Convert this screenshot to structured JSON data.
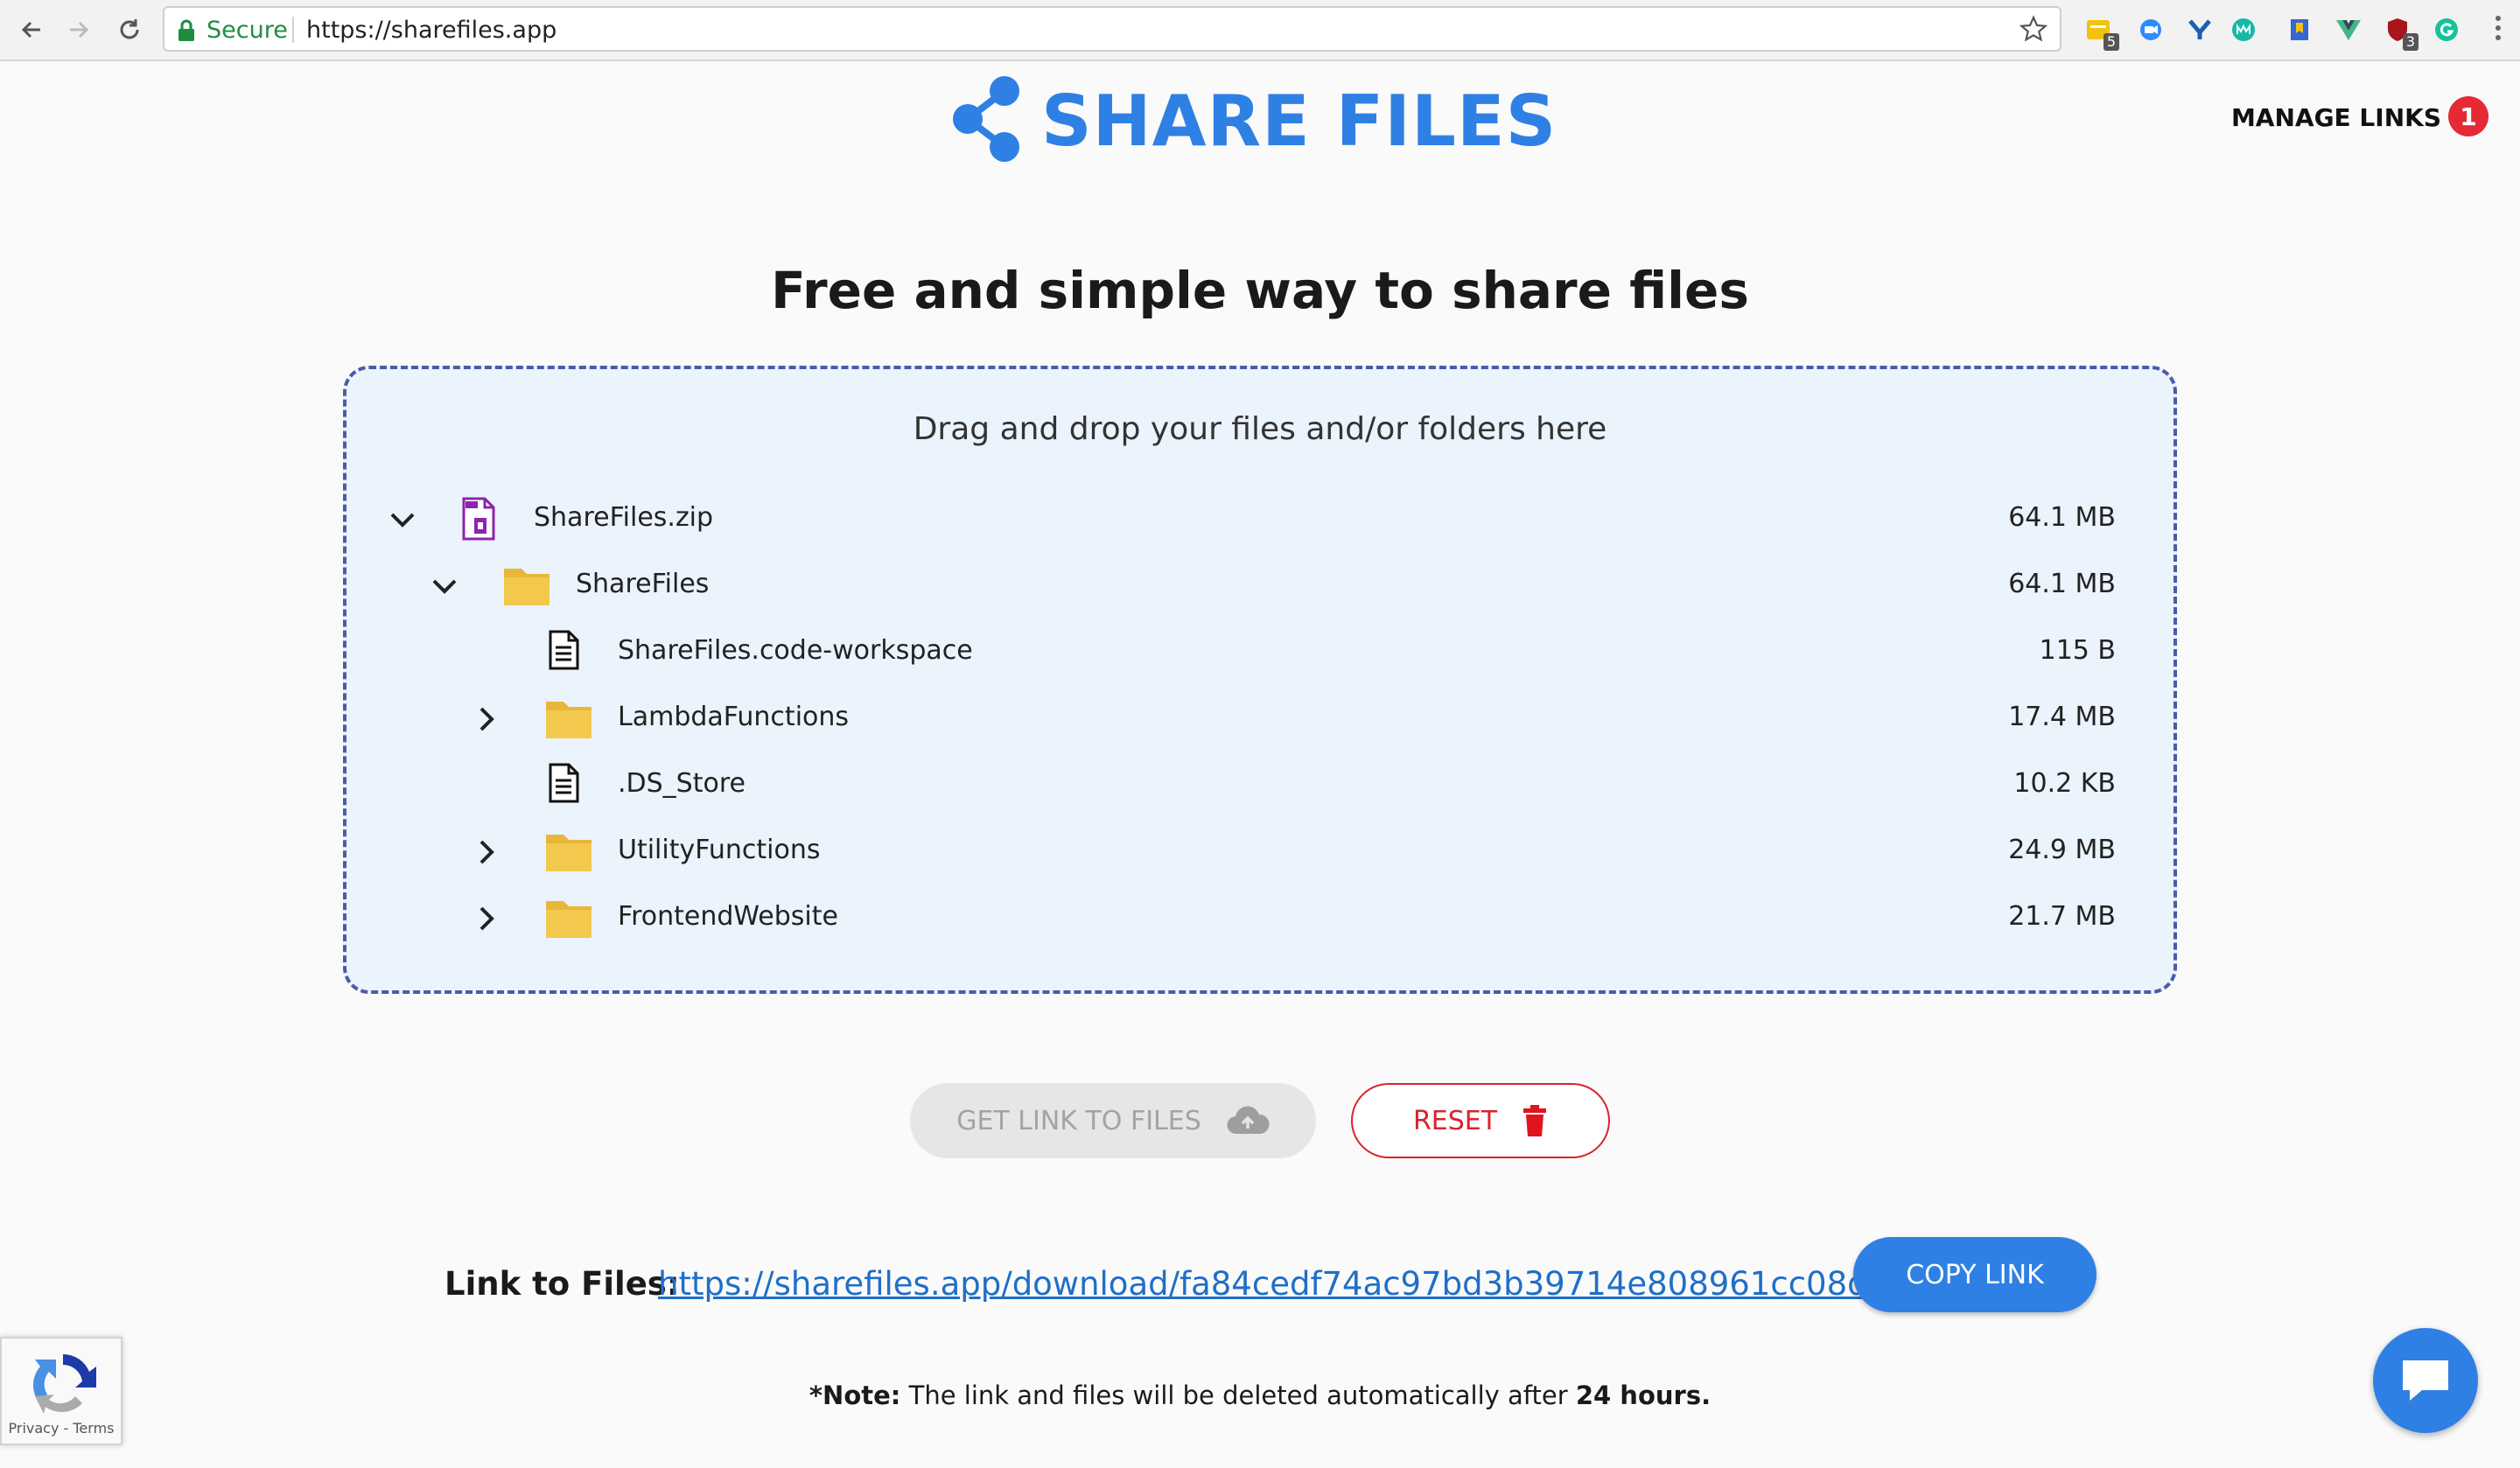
{
  "browser": {
    "secure_label": "Secure",
    "url": "https://sharefiles.app",
    "extensions": [
      {
        "icon": "notes-extension-icon",
        "badge": "5"
      },
      {
        "icon": "video-extension-icon",
        "badge": ""
      },
      {
        "icon": "y-extension-icon",
        "badge": ""
      },
      {
        "icon": "m-extension-icon",
        "badge": ""
      },
      {
        "icon": "bookmark-extension-icon",
        "badge": ""
      },
      {
        "icon": "vue-devtools-icon",
        "badge": ""
      },
      {
        "icon": "shield-extension-icon",
        "badge": "3"
      },
      {
        "icon": "grammarly-icon",
        "badge": ""
      }
    ]
  },
  "header": {
    "logo_text": "SHARE FILES",
    "manage_links_label": "MANAGE LINKS",
    "manage_links_count": "1"
  },
  "main": {
    "headline": "Free and simple way to share files",
    "drop_hint": "Drag and drop your files and/or folders here",
    "files": [
      {
        "name": "ShareFiles.zip",
        "size": "64.1 MB",
        "type": "zip",
        "depth": 0,
        "toggle": "expanded"
      },
      {
        "name": "ShareFiles",
        "size": "64.1 MB",
        "type": "folder",
        "depth": 1,
        "toggle": "expanded"
      },
      {
        "name": "ShareFiles.code-workspace",
        "size": "115 B",
        "type": "file",
        "depth": 2,
        "toggle": "none"
      },
      {
        "name": "LambdaFunctions",
        "size": "17.4 MB",
        "type": "folder",
        "depth": 2,
        "toggle": "collapsed"
      },
      {
        "name": ".DS_Store",
        "size": "10.2 KB",
        "type": "file",
        "depth": 2,
        "toggle": "none"
      },
      {
        "name": "UtilityFunctions",
        "size": "24.9 MB",
        "type": "folder",
        "depth": 2,
        "toggle": "collapsed"
      },
      {
        "name": "FrontendWebsite",
        "size": "21.7 MB",
        "type": "folder",
        "depth": 2,
        "toggle": "collapsed"
      }
    ],
    "get_link_label": "GET LINK TO FILES",
    "reset_label": "RESET",
    "link_label": "Link to Files:",
    "link_url": "https://sharefiles.app/download/fa84cedf74ac97bd3b39714e808961cc08d92095",
    "copy_label": "COPY LINK",
    "note_prefix": "*Note:",
    "note_text": " The link and files will be deleted automatically after ",
    "note_hours": "24 hours."
  },
  "recaptcha": {
    "label": "Privacy - Terms"
  },
  "colors": {
    "brand": "#2f80e4",
    "danger": "#d9232d",
    "folder": "#f2c94c",
    "zip": "#8e24aa"
  }
}
